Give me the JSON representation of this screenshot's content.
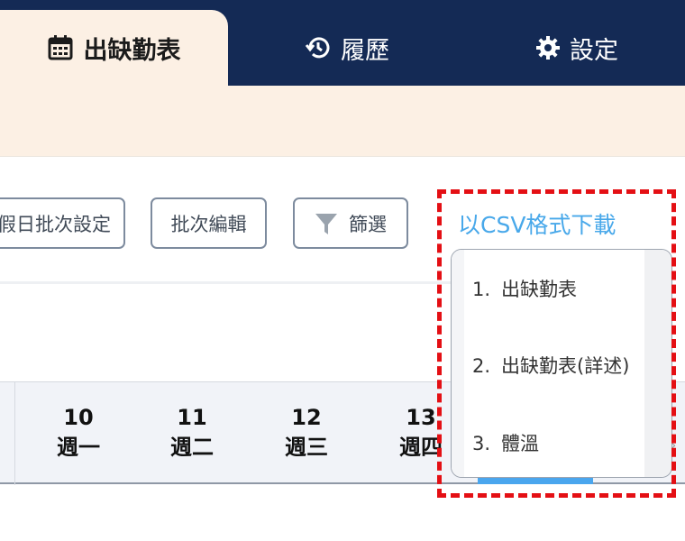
{
  "nav": {
    "tabs": [
      {
        "label": "出缺勤表",
        "icon": "calendar-icon",
        "active": true
      },
      {
        "label": "履歷",
        "icon": "history-icon"
      },
      {
        "label": "設定",
        "icon": "gear-icon"
      }
    ],
    "background": "#142a55",
    "active_background": "#fcf0e4"
  },
  "toolbar": {
    "batch_date_label": "假日批次設定",
    "batch_edit_label": "批次編輯",
    "filter_label": "篩選",
    "filter_icon": "filter-icon",
    "csv_download_label": "以CSV格式下載",
    "link_color": "#48a8ea"
  },
  "calendar": {
    "days": [
      {
        "date": "10",
        "weekday": "週一"
      },
      {
        "date": "11",
        "weekday": "週二"
      },
      {
        "date": "12",
        "weekday": "週三"
      },
      {
        "date": "13",
        "weekday": "週四"
      }
    ]
  },
  "csv_menu": {
    "items": [
      {
        "index": "1.",
        "label": "出缺勤表"
      },
      {
        "index": "2.",
        "label": "出缺勤表(詳述)"
      },
      {
        "index": "3.",
        "label": "體溫"
      }
    ],
    "highlight_color": "#e40f14"
  }
}
